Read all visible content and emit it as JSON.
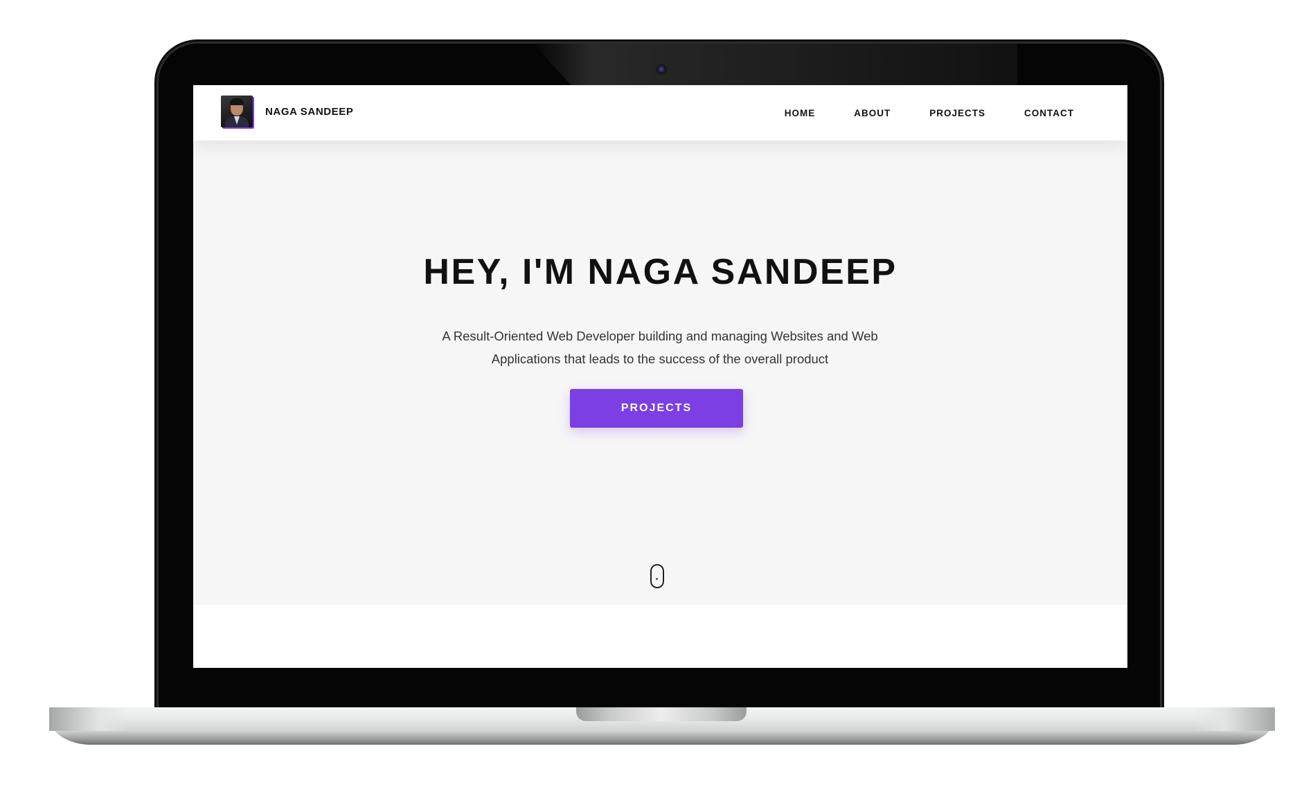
{
  "navbar": {
    "brand_name": "NAGA SANDEEP",
    "links": [
      "HOME",
      "ABOUT",
      "PROJECTS",
      "CONTACT"
    ]
  },
  "hero": {
    "title": "HEY, I'M NAGA SANDEEP",
    "subtitle_line1": "A Result-Oriented Web Developer building and managing Websites and Web",
    "subtitle_line2": "Applications that leads to the success of the overall product",
    "button_label": "PROJECTS"
  },
  "colors": {
    "accent": "#7b3fe4",
    "hero_background": "#f6f6f6",
    "text": "#111111"
  },
  "icons": {
    "avatar": "profile-photo",
    "scroll": "mouse-scroll-icon",
    "camera": "webcam"
  }
}
